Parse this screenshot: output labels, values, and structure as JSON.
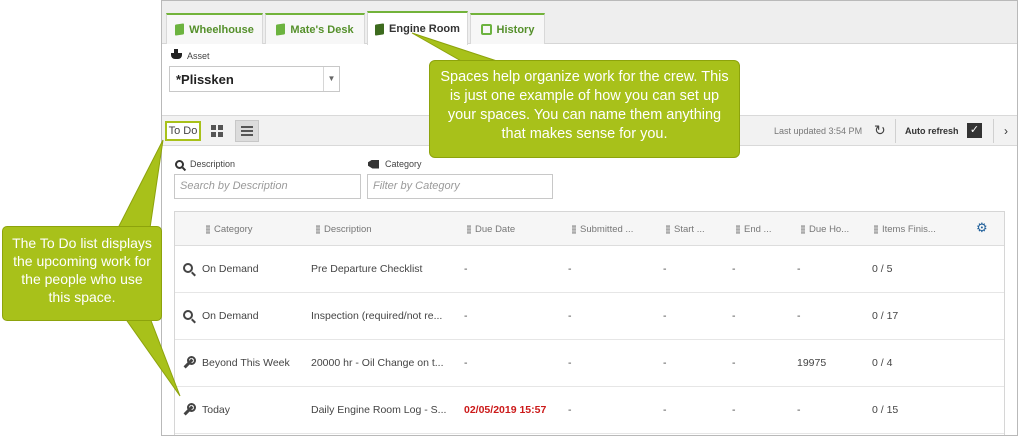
{
  "tabs": [
    {
      "label": "Wheelhouse",
      "icon": "book-icon",
      "active": false
    },
    {
      "label": "Mate's Desk",
      "icon": "book-icon",
      "active": false
    },
    {
      "label": "Engine Room",
      "icon": "book-icon",
      "active": true
    },
    {
      "label": "History",
      "icon": "history-icon",
      "active": false
    }
  ],
  "asset": {
    "label": "Asset",
    "value": "*Plissken"
  },
  "toolbar": {
    "view_label": "To Do",
    "last_updated": "Last updated 3:54 PM",
    "auto_refresh": "Auto refresh"
  },
  "filters": {
    "description": {
      "label": "Description",
      "placeholder": "Search by Description"
    },
    "category": {
      "label": "Category",
      "placeholder": "Filter by Category"
    }
  },
  "table": {
    "columns": [
      "Category",
      "Description",
      "Due Date",
      "Submitted ...",
      "Start ...",
      "End ...",
      "Due Ho...",
      "Items Finis..."
    ],
    "rows": [
      {
        "icon": "zoom-icon",
        "category": "On Demand",
        "description": "Pre Departure Checklist",
        "due_date": "-",
        "submitted": "-",
        "start": "-",
        "end": "-",
        "due_hours": "-",
        "items": "0 / 5"
      },
      {
        "icon": "zoom-icon",
        "category": "On Demand",
        "description": "Inspection (required/not re...",
        "due_date": "-",
        "submitted": "-",
        "start": "-",
        "end": "-",
        "due_hours": "-",
        "items": "0 / 17"
      },
      {
        "icon": "wrench-icon",
        "category": "Beyond This Week",
        "description": "20000 hr - Oil Change on t...",
        "due_date": "-",
        "submitted": "-",
        "start": "-",
        "end": "-",
        "due_hours": "19975",
        "items": "0 / 4"
      },
      {
        "icon": "wrench-icon",
        "category": "Today",
        "description": "Daily Engine Room Log - S...",
        "due_date": "02/05/2019 15:57",
        "submitted": "-",
        "start": "-",
        "end": "-",
        "due_hours": "-",
        "items": "0 / 15"
      }
    ]
  },
  "callouts": {
    "top": "Spaces help organize work for the crew. This is just one example of how you can set up your spaces. You can name them anything that makes sense for you.",
    "left": "The To Do list displays the upcoming work for the people who use this space."
  },
  "colors": {
    "accent_green": "#a8c11a",
    "tab_green": "#72b33a",
    "due_red": "#cc1a1a",
    "gear_blue": "#1f5f9a"
  }
}
